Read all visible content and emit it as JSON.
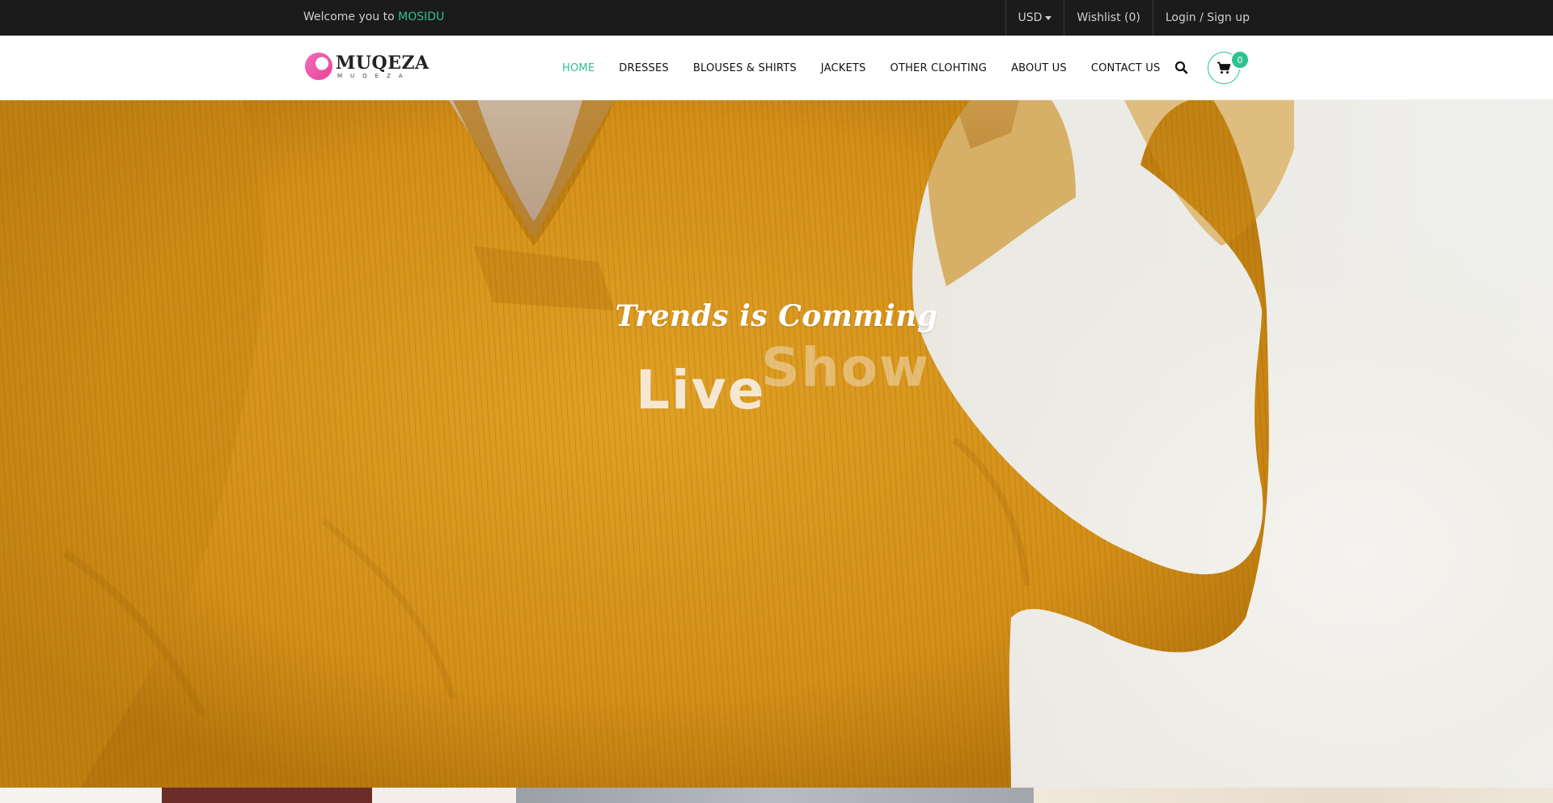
{
  "topbar": {
    "welcome_prefix": "Welcome you to",
    "welcome_brand": "MOSIDU",
    "currency": "USD",
    "wishlist": "Wishlist (0)",
    "login": "Login / Sign up"
  },
  "header": {
    "logo_title": "MUQEZA",
    "logo_tagline": "MUQEZA",
    "nav": [
      {
        "label": "HOME",
        "active": true
      },
      {
        "label": "DRESSES"
      },
      {
        "label": "BLOUSES & SHIRTS"
      },
      {
        "label": "JACKETS"
      },
      {
        "label": "OTHER CLOHTING"
      },
      {
        "label": "ABOUT US"
      },
      {
        "label": "CONTACT US"
      }
    ],
    "cart_count": "0",
    "icons": {
      "search": "search-icon",
      "cart": "cart-icon"
    }
  },
  "hero": {
    "subtitle": "Trends is Comming",
    "title_word1": "Live",
    "title_word2": "Show"
  },
  "colors": {
    "accent": "#2ec28f",
    "topbar_bg": "#1b1b1b",
    "sweater": "#d8921a",
    "logo_pink": "#e94399"
  }
}
